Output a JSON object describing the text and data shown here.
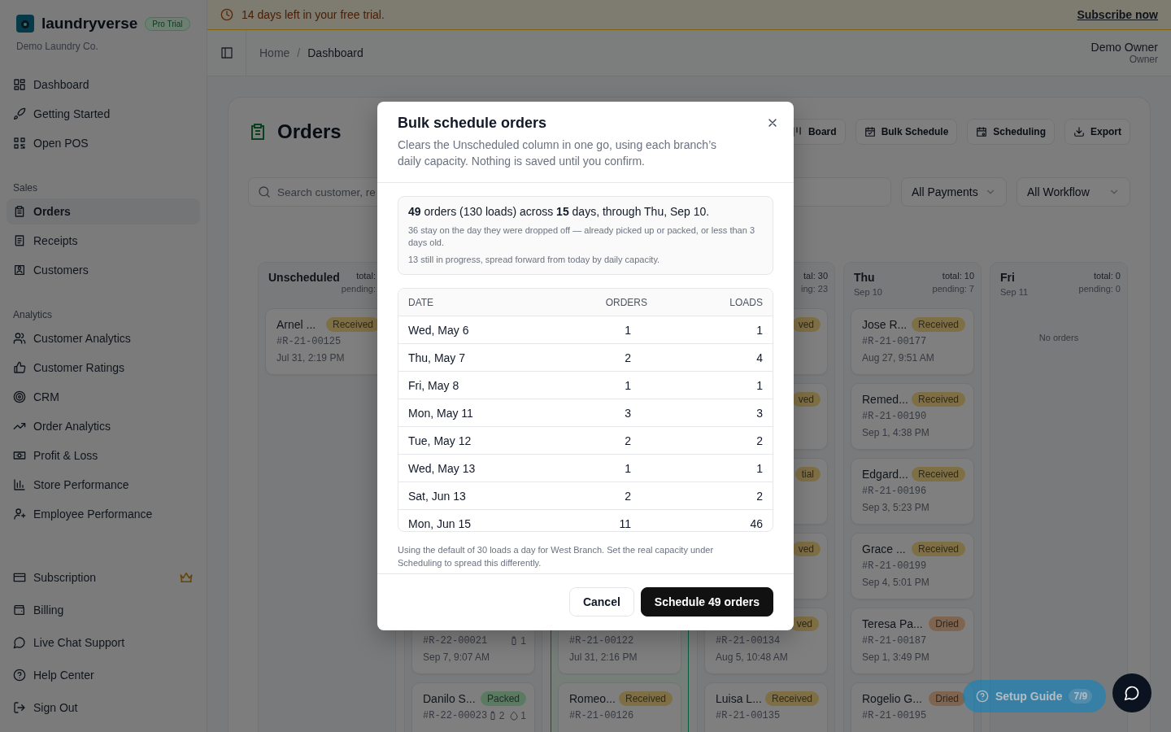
{
  "sidebar": {
    "brand": "laundryverse",
    "plan_badge": "Pro Trial",
    "org": "Demo Laundry Co.",
    "sections": [
      {
        "items": [
          {
            "label": "Dashboard",
            "selected": false
          },
          {
            "label": "Getting Started",
            "selected": false
          },
          {
            "label": "Open POS",
            "selected": false
          }
        ]
      },
      {
        "label": "Sales",
        "items": [
          {
            "label": "Orders",
            "selected": true
          },
          {
            "label": "Receipts",
            "selected": false
          },
          {
            "label": "Customers",
            "selected": false
          }
        ]
      },
      {
        "label": "Analytics",
        "items": [
          {
            "label": "Customer Analytics",
            "selected": false
          },
          {
            "label": "Customer Ratings",
            "selected": false
          },
          {
            "label": "CRM",
            "selected": false
          },
          {
            "label": "Order Analytics",
            "selected": false
          },
          {
            "label": "Profit & Loss",
            "selected": false
          },
          {
            "label": "Store Performance",
            "selected": false
          },
          {
            "label": "Employee Performance",
            "selected": false
          }
        ]
      }
    ],
    "footer_items": [
      {
        "label": "Subscription",
        "selected": false,
        "premium": true
      },
      {
        "label": "Billing",
        "selected": false,
        "premium": false
      },
      {
        "label": "Live Chat Support",
        "selected": false,
        "premium": false
      },
      {
        "label": "Help Center",
        "selected": false,
        "premium": false
      },
      {
        "label": "Sign Out",
        "selected": false,
        "premium": false
      }
    ]
  },
  "trial_banner": {
    "text": "14 days left in your free trial.",
    "link": "Subscribe now"
  },
  "header": {
    "breadcrumb": [
      "Home",
      "Dashboard"
    ],
    "breadcrumb_separator": "/",
    "user_name": "Demo Owner",
    "user_role": "Owner"
  },
  "page": {
    "title": "Orders",
    "actions": [
      "Board",
      "Bulk Schedule",
      "Scheduling",
      "Export"
    ],
    "search": {
      "placeholder": "Search customer, re"
    },
    "filters": [
      "All Payments",
      "All Workflow"
    ]
  },
  "board": {
    "columns": [
      {
        "title": "Unscheduled",
        "total": "total:",
        "pending": "pending:",
        "highlighted": false,
        "cards": [
          {
            "kind": "card",
            "name": "Arnel ...",
            "status": "Received",
            "color": "#7f6f45",
            "ref": "#R-21-00125",
            "time": "Jul 31, 2:19 PM"
          }
        ]
      },
      {
        "highlighted": false,
        "cards": [
          {
            "kind": "covered"
          },
          {
            "kind": "covered"
          },
          {
            "kind": "covered"
          },
          {
            "kind": "covered"
          },
          {
            "kind": "card",
            "ref": "#R-22-00021",
            "time": "Sep 7, 9:07 AM",
            "meta": [
              {
                "kind": "bottle",
                "count": "1"
              }
            ]
          },
          {
            "kind": "card",
            "name": "Danilo S...",
            "status": "Packed",
            "color": "#5a7a62",
            "ref": "#R-22-00023",
            "meta": [
              {
                "kind": "bottle",
                "count": "2"
              },
              {
                "kind": "drop",
                "count": "1"
              }
            ]
          }
        ]
      },
      {
        "highlighted": true,
        "cards": [
          {
            "kind": "covered"
          },
          {
            "kind": "covered"
          },
          {
            "kind": "covered"
          },
          {
            "kind": "covered"
          },
          {
            "kind": "card",
            "ref": "#R-21-00122",
            "time": "Jul 31, 2:16 PM"
          },
          {
            "kind": "card",
            "name": "Romeo...",
            "status": "Received",
            "color": "#7f6f45",
            "ref": "#R-21-00126"
          }
        ]
      },
      {
        "total": "tal: 30",
        "pending": "ing: 23",
        "highlighted": false,
        "cards": [
          {
            "kind": "edge",
            "status": "ved",
            "color": "#7f6f45"
          },
          {
            "kind": "edge",
            "status": "ved",
            "color": "#7f6f45"
          },
          {
            "kind": "edge",
            "status": "tial",
            "color": "#7f6f45"
          },
          {
            "kind": "edge",
            "status": "ved",
            "color": "#7f6f45"
          },
          {
            "kind": "card",
            "status": "ved",
            "color": "#7f6f45",
            "ref": "#R-21-00134",
            "time": "Aug 5, 10:48 AM"
          },
          {
            "kind": "card",
            "name": "Luisa L...",
            "status": "Received",
            "color": "#7f6f45",
            "ref": "#R-21-00135"
          }
        ]
      },
      {
        "title": "Thu",
        "date": "Sep 10",
        "total": "total: 10",
        "pending": "pending: 7",
        "highlighted": false,
        "cards": [
          {
            "kind": "card",
            "name": "Jose R...",
            "status": "Received",
            "color": "#7f6f45",
            "ref": "#R-21-00177",
            "time": "Aug 27, 9:51 AM"
          },
          {
            "kind": "card",
            "name": "Remed...",
            "status": "Received",
            "color": "#7f6f45",
            "ref": "#R-21-00190",
            "time": "Sep 1, 4:38 PM"
          },
          {
            "kind": "card",
            "name": "Edgard...",
            "status": "Received",
            "color": "#7f6f45",
            "ref": "#R-21-00196",
            "time": "Sep 3, 5:23 PM"
          },
          {
            "kind": "card",
            "name": "Grace ...",
            "status": "Received",
            "color": "#7f6f45",
            "ref": "#R-21-00199",
            "time": "Sep 4, 5:01 PM"
          },
          {
            "kind": "card",
            "name": "Teresa Pa...",
            "status": "Dried",
            "color": "#80654f",
            "ref": "#R-21-00187",
            "time": "Sep 1, 3:49 PM"
          },
          {
            "kind": "card",
            "name": "Rogelio G...",
            "status": "Dried",
            "color": "#80654f",
            "ref": "#R-21-00195"
          }
        ]
      },
      {
        "title": "Fri",
        "date": "Sep 11",
        "total": "total: 0",
        "pending": "pending: 0",
        "highlighted": false,
        "empty_text": "No orders"
      }
    ]
  },
  "setup_guide": {
    "label": "Setup Guide",
    "progress": "7/9"
  },
  "dialog": {
    "title": "Bulk schedule orders",
    "description": "Clears the Unscheduled column in one go, using each branch’s daily capacity. Nothing is saved until you confirm.",
    "summary": "**49** orders (130 loads) across **15** days, through Thu, Sep 10.",
    "notes": [
      "36 stay on the day they were dropped off — already picked up or packed, or less than 3 days old.",
      "13 still in progress, spread forward from today by daily capacity."
    ],
    "table": {
      "columns": [
        "DATE",
        "ORDERS",
        "LOADS"
      ],
      "rows": [
        [
          "Wed, May 6",
          "1",
          "1"
        ],
        [
          "Thu, May 7",
          "2",
          "4"
        ],
        [
          "Fri, May 8",
          "1",
          "1"
        ],
        [
          "Mon, May 11",
          "3",
          "3"
        ],
        [
          "Tue, May 12",
          "2",
          "2"
        ],
        [
          "Wed, May 13",
          "1",
          "1"
        ],
        [
          "Sat, Jun 13",
          "2",
          "2"
        ],
        [
          "Mon, Jun 15",
          "11",
          "46"
        ]
      ]
    },
    "footnote": "Using the default of 30 loads a day for West Branch. Set the real capacity under Scheduling to spread this differently.",
    "buttons": {
      "cancel": "Cancel",
      "confirm": "Schedule 49 orders"
    }
  }
}
